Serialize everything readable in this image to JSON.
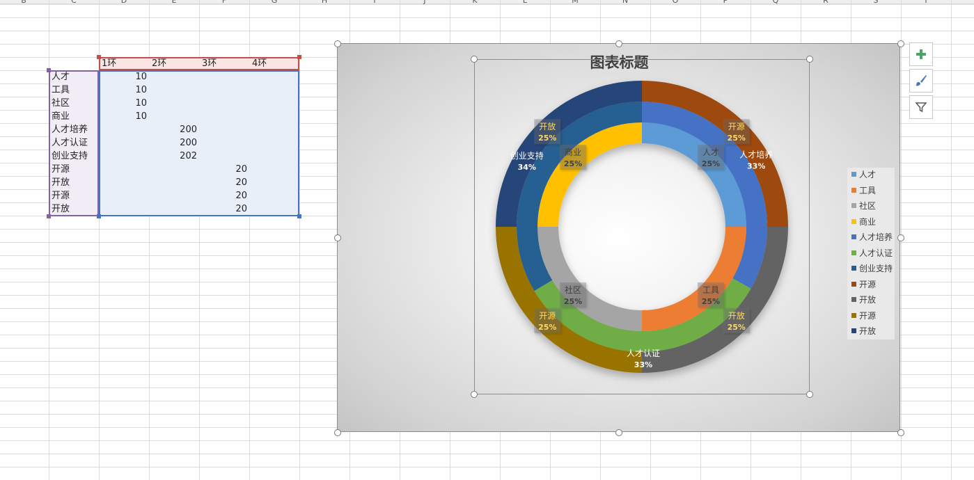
{
  "spreadsheet": {
    "column_headers": [
      "B",
      "C",
      "D",
      "E",
      "F",
      "G",
      "H",
      "I",
      "J",
      "K",
      "L",
      "M",
      "N",
      "O",
      "P",
      "Q",
      "R",
      "S",
      "T"
    ],
    "header_row": [
      "1环",
      "2环",
      "3环",
      "4环"
    ],
    "row_labels": [
      "人才",
      "工具",
      "社区",
      "商业",
      "人才培养",
      "人才认证",
      "创业支持",
      "开源",
      "开放",
      "开源",
      "开放"
    ],
    "ring1_values": [
      "10",
      "10",
      "10",
      "10",
      "",
      "",
      "",
      "",
      "",
      "",
      ""
    ],
    "ring2_values": [
      "",
      "",
      "",
      "",
      "200",
      "200",
      "202",
      "",
      "",
      "",
      ""
    ],
    "ring3_values": [
      "",
      "",
      "",
      "",
      "",
      "",
      "",
      "20",
      "20",
      "20",
      "20"
    ]
  },
  "chart_title": "图表标题",
  "chart_data": {
    "type": "doughnut",
    "title": "图表标题",
    "categories": [
      "人才",
      "工具",
      "社区",
      "商业",
      "人才培养",
      "人才认证",
      "创业支持",
      "开源",
      "开放",
      "开源",
      "开放"
    ],
    "series": [
      {
        "name": "1环",
        "values": [
          10,
          10,
          10,
          10,
          null,
          null,
          null,
          null,
          null,
          null,
          null
        ]
      },
      {
        "name": "2环",
        "values": [
          null,
          null,
          null,
          null,
          200,
          200,
          202,
          null,
          null,
          null,
          null
        ]
      },
      {
        "name": "3环",
        "values": [
          null,
          null,
          null,
          null,
          null,
          null,
          null,
          20,
          20,
          20,
          20
        ]
      },
      {
        "name": "4环",
        "values": [
          null,
          null,
          null,
          null,
          null,
          null,
          null,
          null,
          null,
          null,
          null
        ]
      }
    ],
    "colors": [
      "#5b9bd5",
      "#ed7d31",
      "#a5a5a5",
      "#ffc000",
      "#4472c4",
      "#70ad47",
      "#255e91",
      "#9e480e",
      "#636363",
      "#997300",
      "#264478"
    ],
    "data_labels": [
      {
        "name": "人才",
        "pct": "25%",
        "color": "#404040"
      },
      {
        "name": "工具",
        "pct": "25%",
        "color": "#404040"
      },
      {
        "name": "社区",
        "pct": "25%",
        "color": "#404040"
      },
      {
        "name": "商业",
        "pct": "25%",
        "color": "#404040"
      },
      {
        "name": "人才培养",
        "pct": "33%",
        "color": "#ffffff"
      },
      {
        "name": "人才认证",
        "pct": "33%",
        "color": "#ffffff"
      },
      {
        "name": "创业支持",
        "pct": "34%",
        "color": "#ffffff"
      },
      {
        "name": "开源",
        "pct": "25%",
        "color": "#ffd966"
      },
      {
        "name": "开放",
        "pct": "25%",
        "color": "#ffd966"
      },
      {
        "name": "开源",
        "pct": "25%",
        "color": "#ffd966"
      },
      {
        "name": "开放",
        "pct": "25%",
        "color": "#ffd966"
      }
    ],
    "legend_position": "right"
  },
  "legend": [
    {
      "label": "人才",
      "color": "#5b9bd5"
    },
    {
      "label": "工具",
      "color": "#ed7d31"
    },
    {
      "label": "社区",
      "color": "#a5a5a5"
    },
    {
      "label": "商业",
      "color": "#ffc000"
    },
    {
      "label": "人才培养",
      "color": "#4472c4"
    },
    {
      "label": "人才认证",
      "color": "#70ad47"
    },
    {
      "label": "创业支持",
      "color": "#255e91"
    },
    {
      "label": "开源",
      "color": "#9e480e"
    },
    {
      "label": "开放",
      "color": "#636363"
    },
    {
      "label": "开源",
      "color": "#997300"
    },
    {
      "label": "开放",
      "color": "#264478"
    }
  ],
  "side_buttons": [
    "chart-elements-icon",
    "chart-styles-icon",
    "chart-filter-icon"
  ]
}
